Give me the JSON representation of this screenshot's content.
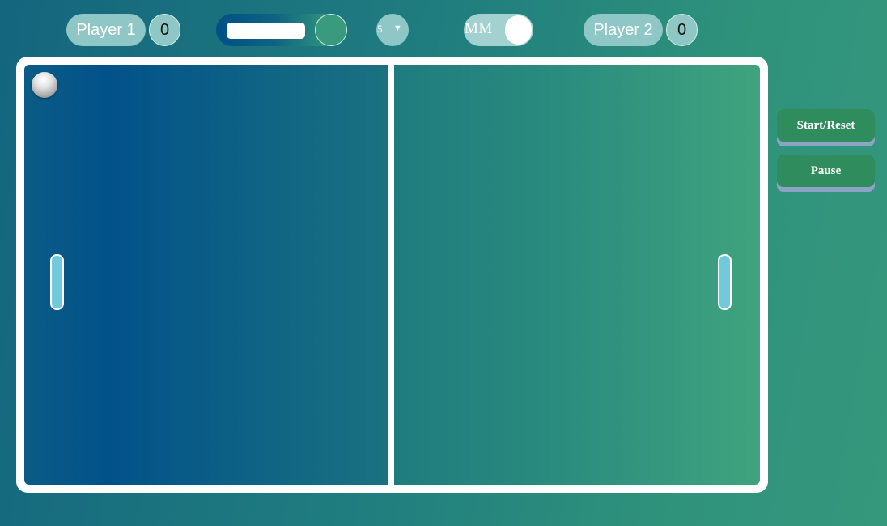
{
  "header": {
    "player1": {
      "label": "Player 1",
      "score": "0"
    },
    "player2": {
      "label": "Player 2",
      "score": "0"
    },
    "speed": {
      "thumb_position": "right"
    },
    "level": {
      "value": "5",
      "caret": "▼"
    },
    "mode": {
      "label": "MM",
      "state": "on"
    }
  },
  "game": {
    "ball_icon": "ball",
    "paddles": [
      "left-paddle",
      "right-paddle"
    ],
    "colors": {
      "court_border": "#ffffff",
      "left_half": "#02528a",
      "right_half": "#3fa37e",
      "paddle": "#72c9dc"
    }
  },
  "controls": {
    "start_reset_label": "Start/Reset",
    "pause_label": "Pause",
    "button_color": "#2f8c5d"
  }
}
